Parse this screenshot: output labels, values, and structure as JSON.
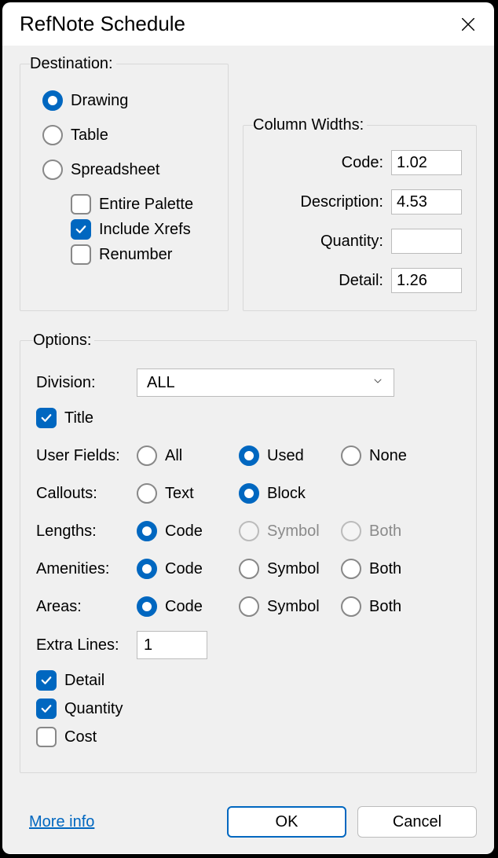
{
  "title": "RefNote Schedule",
  "destination": {
    "legend": "Destination:",
    "radios": {
      "drawing": "Drawing",
      "table": "Table",
      "spreadsheet": "Spreadsheet"
    },
    "checks": {
      "entire_palette": "Entire Palette",
      "include_xrefs": "Include Xrefs",
      "renumber": "Renumber"
    }
  },
  "column_widths": {
    "legend": "Column Widths:",
    "labels": {
      "code": "Code:",
      "description": "Description:",
      "quantity": "Quantity:",
      "detail": "Detail:"
    },
    "values": {
      "code": "1.02",
      "description": "4.53",
      "quantity": "",
      "detail": "1.26"
    }
  },
  "options": {
    "legend": "Options:",
    "division_label": "Division:",
    "division_value": "ALL",
    "title_label": "Title",
    "user_fields": {
      "label": "User Fields:",
      "all": "All",
      "used": "Used",
      "none": "None"
    },
    "callouts": {
      "label": "Callouts:",
      "text": "Text",
      "block": "Block"
    },
    "lengths": {
      "label": "Lengths:",
      "code": "Code",
      "symbol": "Symbol",
      "both": "Both"
    },
    "amenities": {
      "label": "Amenities:",
      "code": "Code",
      "symbol": "Symbol",
      "both": "Both"
    },
    "areas": {
      "label": "Areas:",
      "code": "Code",
      "symbol": "Symbol",
      "both": "Both"
    },
    "extra_lines": {
      "label": "Extra Lines:",
      "value": "1"
    },
    "detail_label": "Detail",
    "quantity_label": "Quantity",
    "cost_label": "Cost"
  },
  "footer": {
    "more_info": "More info",
    "ok": "OK",
    "cancel": "Cancel"
  }
}
